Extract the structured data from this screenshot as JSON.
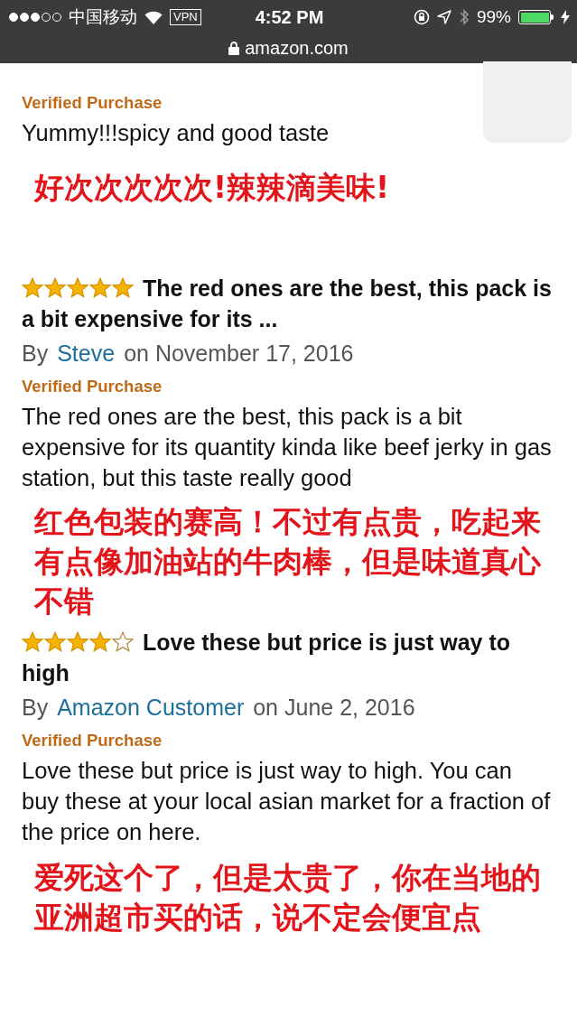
{
  "status_bar": {
    "carrier": "中国移动",
    "vpn": "VPN",
    "time": "4:52 PM",
    "battery": "99%"
  },
  "address_bar": {
    "url": "amazon.com"
  },
  "reviews": [
    {
      "verified": "Verified Purchase",
      "body": "Yummy!!!spicy and good taste",
      "note": "好次次次次次!辣辣滴美味!"
    },
    {
      "stars": 5,
      "title": "The red ones are the best, this pack is a bit expensive for its ...",
      "by": "By",
      "author": "Steve",
      "date": "on November 17, 2016",
      "verified": "Verified Purchase",
      "body": "The red ones are the best, this pack is a bit expensive for its quantity kinda like beef jerky in gas station, but this taste really good",
      "note": "红色包装的赛高！不过有点贵，吃起来有点像加油站的牛肉棒，但是味道真心不错"
    },
    {
      "stars": 4,
      "title": "Love these but price is just way to high",
      "by": "By",
      "author": "Amazon Customer",
      "date": "on June 2, 2016",
      "verified": "Verified Purchase",
      "body": "Love these but price is just way to high. You can buy these at your local asian market for a fraction of the price on here.",
      "note": "爱死这个了，但是太贵了，你在当地的亚洲超市买的话，说不定会便宜点"
    }
  ]
}
